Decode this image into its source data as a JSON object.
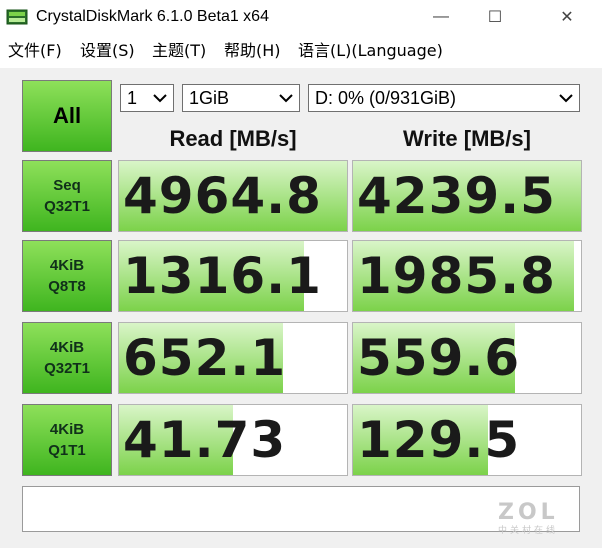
{
  "window": {
    "title": "CrystalDiskMark 6.1.0 Beta1 x64",
    "controls": {
      "minimize": "—",
      "maximize": "☐",
      "close": "✕"
    }
  },
  "menu": [
    "文件(F)",
    "设置(S)",
    "主题(T)",
    "帮助(H)",
    "语言(L)(Language)"
  ],
  "toolbar": {
    "all_label": "All",
    "count": "1",
    "size": "1GiB",
    "drive": "D: 0% (0/931GiB)"
  },
  "headers": {
    "read": "Read [MB/s]",
    "write": "Write [MB/s]"
  },
  "tests": [
    {
      "line1": "Seq",
      "line2": "Q32T1",
      "read": "4964.8",
      "write": "4239.5",
      "read_fill": 1.0,
      "write_fill": 1.0
    },
    {
      "line1": "4KiB",
      "line2": "Q8T8",
      "read": "1316.1",
      "write": "1985.8",
      "read_fill": 0.81,
      "write_fill": 0.97
    },
    {
      "line1": "4KiB",
      "line2": "Q32T1",
      "read": "652.1",
      "write": "559.6",
      "read_fill": 0.72,
      "write_fill": 0.71
    },
    {
      "line1": "4KiB",
      "line2": "Q1T1",
      "read": "41.73",
      "write": "129.5",
      "read_fill": 0.5,
      "write_fill": 0.59
    }
  ],
  "comment": "",
  "watermark": {
    "logo": "ZOL",
    "sub": "中关村在线"
  },
  "colors": {
    "accent_green": "#3fb51f",
    "bar_green": "#7cd24a"
  }
}
